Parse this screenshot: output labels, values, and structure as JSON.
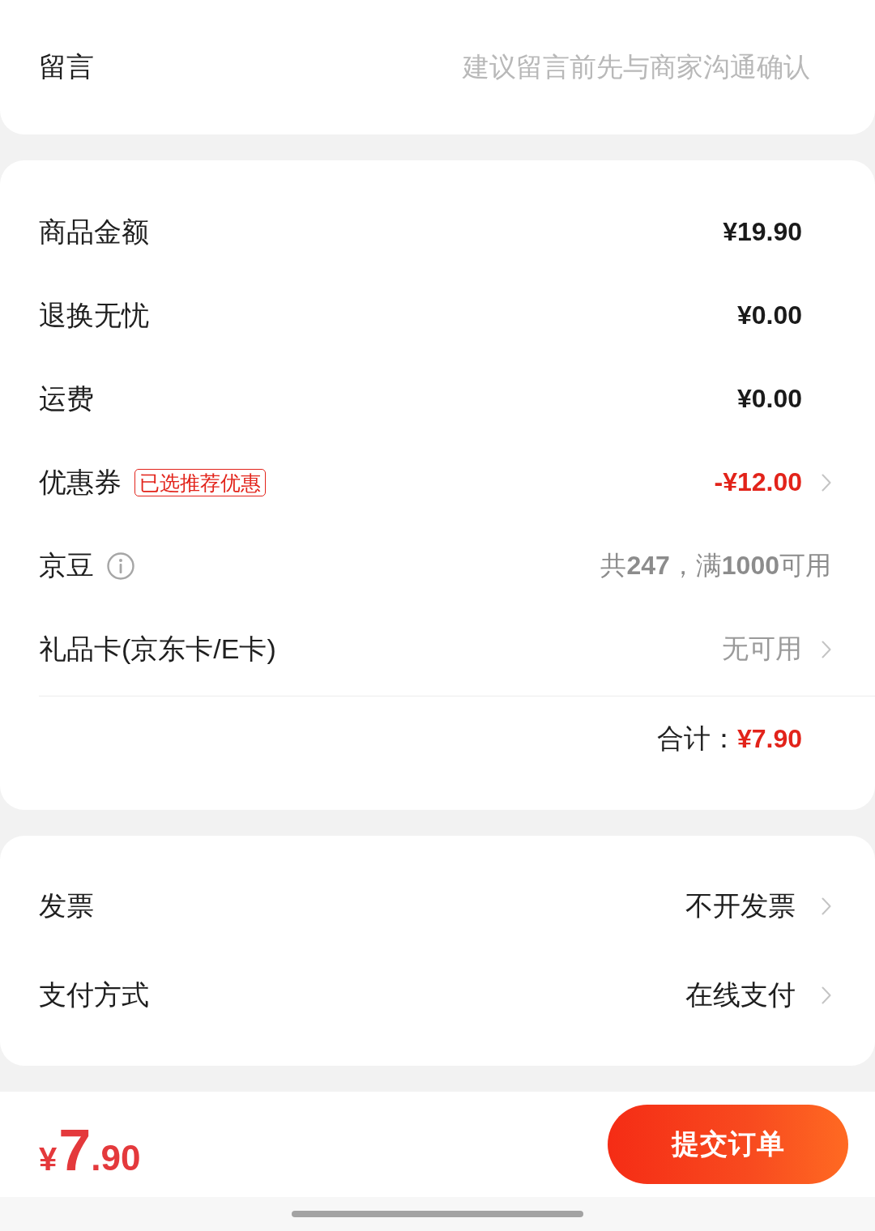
{
  "remark": {
    "label": "留言",
    "placeholder": "建议留言前先与商家沟通确认"
  },
  "summary": {
    "rows": [
      {
        "kind": "amount",
        "label": "商品金额",
        "info": false,
        "value": "¥19.90",
        "chevron": false
      },
      {
        "kind": "amount",
        "label": "退换无忧",
        "info": false,
        "value": "¥0.00",
        "chevron": false
      },
      {
        "kind": "amount",
        "label": "运费",
        "info": false,
        "value": "¥0.00",
        "chevron": false
      },
      {
        "kind": "discount",
        "label": "优惠券",
        "tag": "已选推荐优惠",
        "info": false,
        "value": "-¥12.00",
        "chevron": true
      },
      {
        "kind": "hint",
        "label": "京豆",
        "info": true,
        "value": "共**247**，满**1000**可用",
        "chevron": false
      },
      {
        "kind": "option",
        "label": "礼品卡(京东卡/E卡)",
        "info": false,
        "value": "无可用",
        "chevron": true
      }
    ],
    "total": {
      "label": "合计：",
      "value": "¥7.90"
    }
  },
  "options": {
    "rows": [
      {
        "label": "发票",
        "value": "不开发票",
        "chevron": true
      },
      {
        "label": "支付方式",
        "value": "在线支付",
        "chevron": true
      }
    ]
  },
  "bottom_bar": {
    "price": {
      "currency": "¥",
      "integer": "7",
      "decimal": ".90"
    },
    "submit_button": "提交订单"
  }
}
